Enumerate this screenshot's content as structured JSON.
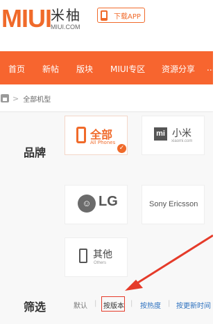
{
  "header": {
    "logo_text": "MIUI",
    "logo_cn": "米柚",
    "logo_site": "MIUI.COM",
    "download_label": "下载APP"
  },
  "nav": {
    "items": [
      "首页",
      "新帖",
      "版块",
      "MIUI专区",
      "资源分享",
      "..."
    ]
  },
  "breadcrumb": {
    "separator": ">",
    "current": "全部机型"
  },
  "brand": {
    "section_label": "品牌",
    "cards": [
      {
        "name": "全部",
        "sub": "All Phones",
        "selected": true
      },
      {
        "name": "小米",
        "sub": "xiaomi.com",
        "logo": "mi"
      },
      {
        "name": "LG",
        "logo": "LG"
      },
      {
        "name": "Sony Ericsson"
      },
      {
        "name": "其他",
        "sub": "Others"
      }
    ],
    "check": "✓"
  },
  "filter": {
    "section_label": "筛选",
    "options": [
      "默认",
      "按版本",
      "按热度",
      "按更新时间"
    ],
    "separator": "|",
    "selected": "按版本"
  },
  "colors": {
    "accent": "#f06a2a",
    "nav_bg": "#f7652f",
    "link": "#2a6fbe",
    "annotation_red": "#e53b2a"
  }
}
